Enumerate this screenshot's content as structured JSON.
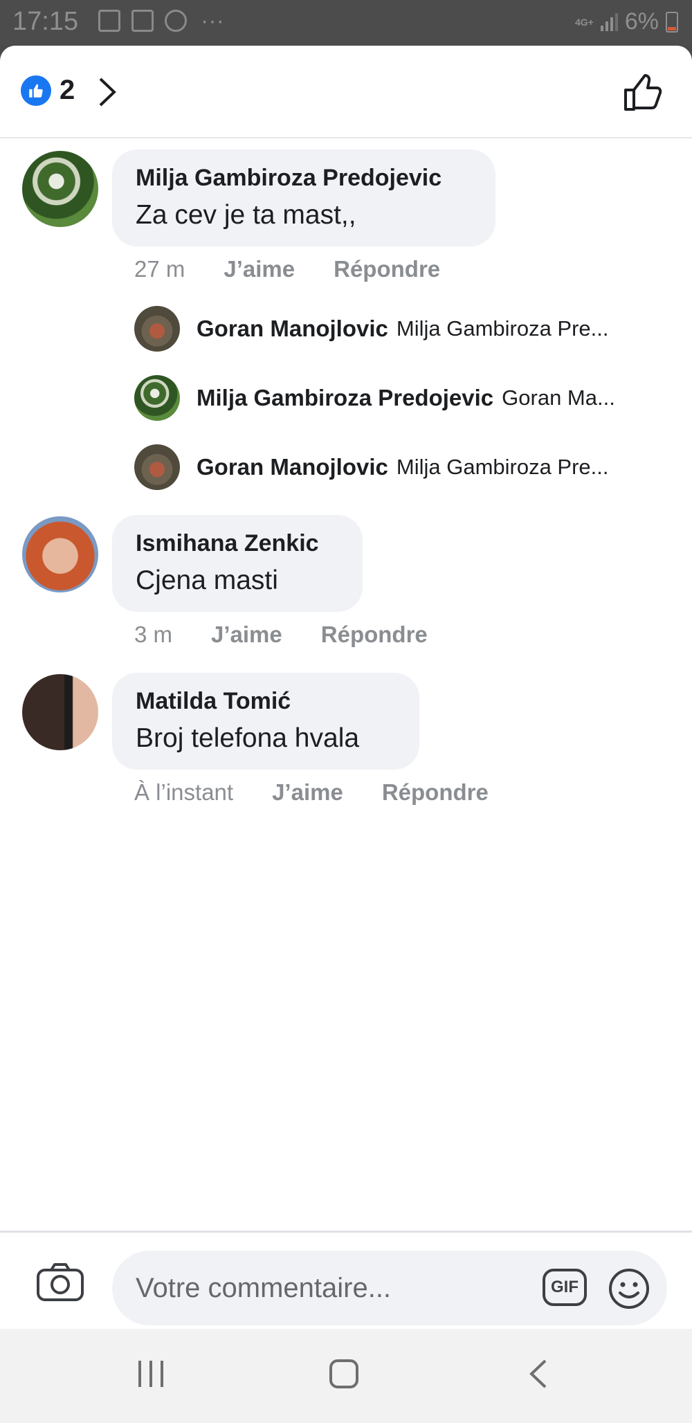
{
  "status_bar": {
    "time": "17:15",
    "network": "4G+",
    "battery": "6%"
  },
  "header": {
    "reaction_count": "2"
  },
  "comments": [
    {
      "author": "Milja Gambiroza Predojevic",
      "text": "Za cev je ta mast,,",
      "time": "27 m",
      "like": "J’aime",
      "reply": "Répondre",
      "replies": [
        {
          "author": "Goran Manojlovic",
          "text": "Milja Gambiroza Pre..."
        },
        {
          "author": "Milja Gambiroza Predojevic",
          "text": "Goran Ma..."
        },
        {
          "author": "Goran Manojlovic",
          "text": "Milja Gambiroza Pre..."
        }
      ]
    },
    {
      "author": "Ismihana Zenkic",
      "text": "Cjena masti",
      "time": "3 m",
      "like": "J’aime",
      "reply": "Répondre"
    },
    {
      "author": "Matilda Tomić",
      "text": "Broj telefona hvala",
      "time": "À l’instant",
      "like": "J’aime",
      "reply": "Répondre"
    }
  ],
  "composer": {
    "placeholder": "Votre commentaire...",
    "gif_label": "GIF"
  },
  "colors": {
    "accent": "#1a77f2",
    "bubble": "#f0f2f5",
    "meta_text": "#8a8d91"
  }
}
